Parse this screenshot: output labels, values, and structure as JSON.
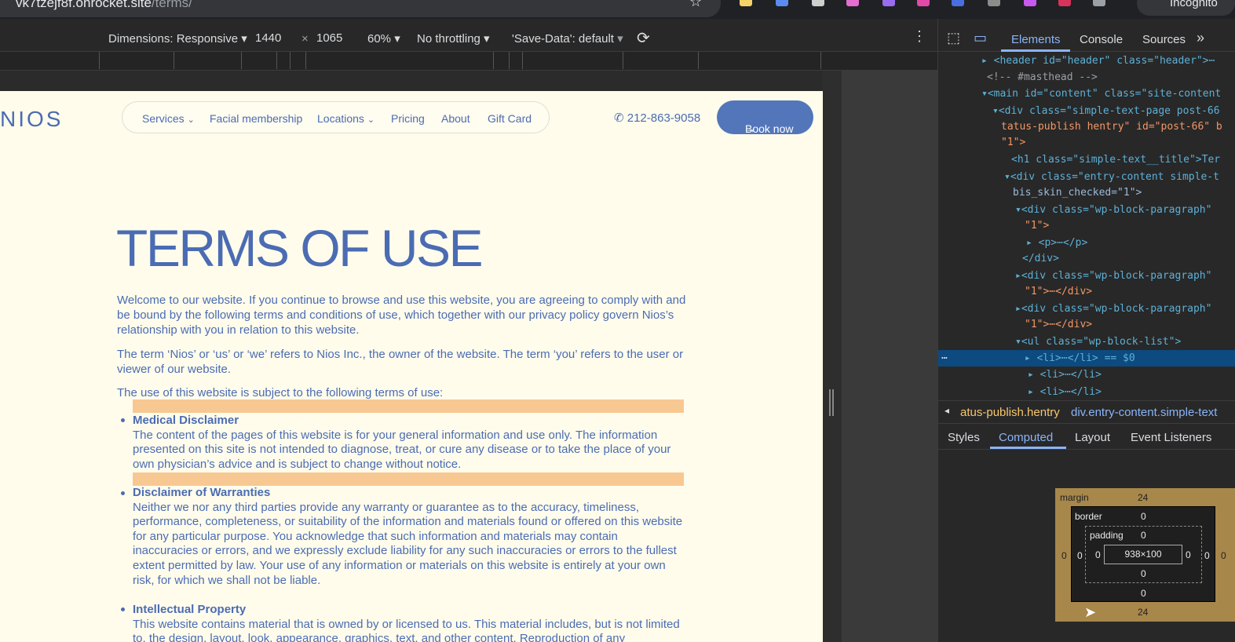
{
  "browser": {
    "url_host": "vk7tzejf8f.onrocket.site",
    "url_path": "/terms/",
    "incognito_label": "Incognito"
  },
  "device_toolbar": {
    "dimensions_label": "Dimensions: Responsive",
    "width": "1440",
    "times": "×",
    "height": "1065",
    "zoom": "60%",
    "throttling": "No throttling",
    "save_data": "'Save-Data': default"
  },
  "site": {
    "logo": "NIOS",
    "nav": [
      {
        "label": "Services"
      },
      {
        "label": "Facial membership"
      },
      {
        "label": "Locations"
      },
      {
        "label": "Pricing"
      },
      {
        "label": "About"
      },
      {
        "label": "Gift Card"
      }
    ],
    "phone": "212-863-9058",
    "book_label": "Book now",
    "title": "TERMS OF USE",
    "paragraphs": [
      "Welcome to our website. If you continue to browse and use this website, you are agreeing to comply with and be bound by the following terms and conditions of use, which together with our privacy policy govern Nios’s relationship with you in relation to this website.",
      "The term ‘Nios’ or ‘us’ or ‘we’ refers to Nios Inc., the owner of the website. The term ‘you’ refers to the user or viewer of our website.",
      "The use of this website is subject to the following terms of use:"
    ],
    "list": [
      {
        "heading": "Medical Disclaimer",
        "body": "The content of the pages of this website is for your general information and use only. The information presented on this site is not intended to diagnose, treat, or cure any disease or to take the place of your own physician’s advice and is subject to change without notice."
      },
      {
        "heading": "Disclaimer of Warranties",
        "body": "Neither we nor any third parties provide any warranty or guarantee as to the accuracy, timeliness, performance, completeness, or suitability of the information and materials found or offered on this website for any particular purpose. You acknowledge that such information and materials may contain inaccuracies or errors, and we expressly exclude liability for any such inaccuracies or errors to the fullest extent permitted by law. Your use of any information or materials on this website is entirely at your own risk, for which we shall not be liable."
      },
      {
        "heading": "Intellectual Property",
        "body": "This website contains material that is owned by or licensed to us. This material includes, but is not limited to, the design, layout, look, appearance, graphics, text, and other content. Reproduction of any"
      }
    ]
  },
  "devtools": {
    "tabs": [
      "Elements",
      "Console",
      "Sources"
    ],
    "more_tabs": "»",
    "lines": [
      {
        "text": "<header id=\"header\" class=\"header\">⋯"
      },
      {
        "text": "<!-- #masthead -->"
      },
      {
        "text": "<main id=\"content\" class=\"site-content"
      },
      {
        "text": "<div class=\"simple-text-page post-66"
      },
      {
        "text": "tatus-publish hentry\" id=\"post-66\" b"
      },
      {
        "text": "\"1\">"
      },
      {
        "text": "<h1 class=\"simple-text__title\">Ter"
      },
      {
        "text": "<div class=\"entry-content simple-t"
      },
      {
        "text": "bis_skin_checked=\"1\">"
      },
      {
        "text": "<div class=\"wp-block-paragraph\""
      },
      {
        "text": "\"1\">"
      },
      {
        "text": "<p>⋯</p>"
      },
      {
        "text": "</div>"
      },
      {
        "text": "<div class=\"wp-block-paragraph\""
      },
      {
        "text": "\"1\">⋯</div>"
      },
      {
        "text": "<div class=\"wp-block-paragraph\""
      },
      {
        "text": "\"1\">⋯</div>"
      },
      {
        "text": "<ul class=\"wp-block-list\">"
      },
      {
        "text": "<li>⋯</li> == $0"
      },
      {
        "text": "<li>⋯</li>"
      },
      {
        "text": "<li>⋯</li>"
      }
    ],
    "crumb1": "atus-publish.hentry",
    "crumb2": "div.entry-content.simple-text",
    "subtabs": [
      "Styles",
      "Computed",
      "Layout",
      "Event Listeners"
    ],
    "box": {
      "margin_label": "margin",
      "margin_top": "24",
      "margin_bottom": "24",
      "margin_left": "0",
      "margin_right": "0",
      "border_label": "border",
      "border_top": "0",
      "border_bottom": "0",
      "border_left": "0",
      "border_right": "0",
      "padding_label": "padding",
      "padding_top": "0",
      "padding_bottom": "0",
      "padding_left": "0",
      "padding_right": "0",
      "content": "938×100"
    }
  }
}
